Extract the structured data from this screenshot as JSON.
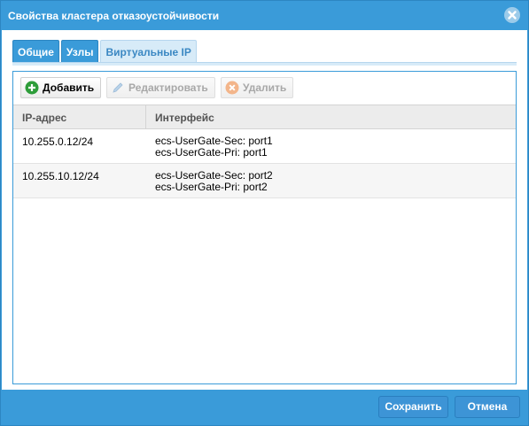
{
  "dialog": {
    "title": "Свойства кластера отказоустойчивости",
    "accent_color": "#3a9bd9"
  },
  "tabs": [
    {
      "label": "Общие",
      "active": false
    },
    {
      "label": "Узлы",
      "active": false
    },
    {
      "label": "Виртуальные IP",
      "active": true
    }
  ],
  "toolbar": {
    "add_label": "Добавить",
    "add_icon": "plus-circle-icon",
    "edit_label": "Редактировать",
    "edit_icon": "pencil-icon",
    "delete_label": "Удалить",
    "delete_icon": "x-circle-icon"
  },
  "table": {
    "columns": [
      "IP-адрес",
      "Интерфейс"
    ],
    "rows": [
      {
        "ip": "10.255.0.12/24",
        "interfaces": [
          "ecs-UserGate-Sec: port1",
          "ecs-UserGate-Pri: port1"
        ]
      },
      {
        "ip": "10.255.10.12/24",
        "interfaces": [
          "ecs-UserGate-Sec: port2",
          "ecs-UserGate-Pri: port2"
        ]
      }
    ]
  },
  "footer": {
    "save_label": "Сохранить",
    "cancel_label": "Отмена"
  }
}
